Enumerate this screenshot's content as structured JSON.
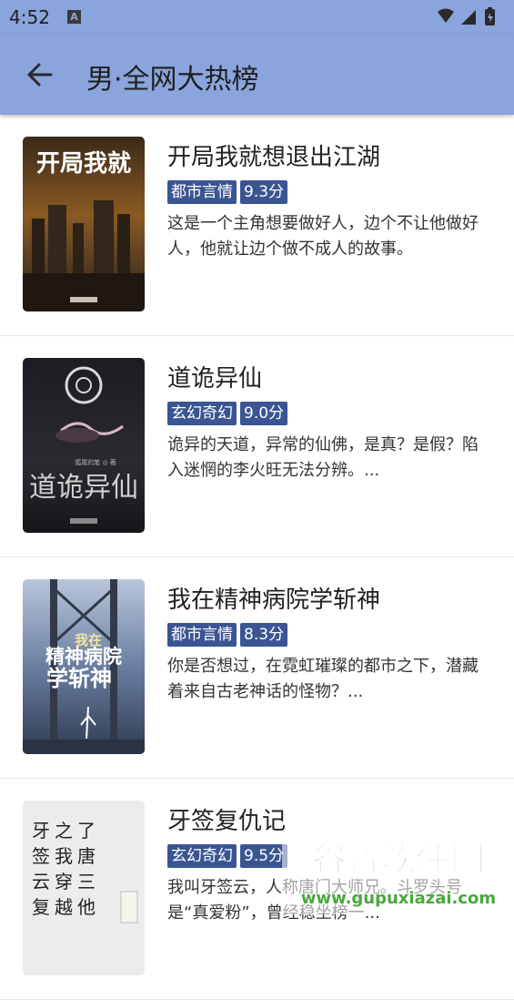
{
  "status_bar": {
    "time": "4:52",
    "notification_icon": "a-icon",
    "icons": [
      "wifi-icon",
      "signal-icon",
      "battery-icon"
    ]
  },
  "header": {
    "back_icon": "arrow-left-icon",
    "title": "男·全网大热榜"
  },
  "books": [
    {
      "title": "开局我就想退出江湖",
      "category": "都市言情",
      "score": "9.3分",
      "description": "这是一个主角想要做好人，边个不让他做好人，他就让边个做不成人的故事。",
      "cover_text": "开局我就"
    },
    {
      "title": "道诡异仙",
      "category": "玄幻奇幻",
      "score": "9.0分",
      "description": "诡异的天道，异常的仙佛，是真？是假？陷入迷惘的李火旺无法分辨。...",
      "cover_text": "道诡异仙",
      "cover_author": "狐尾的笔 ◎ 著"
    },
    {
      "title": "我在精神病院学斩神",
      "category": "都市言情",
      "score": "8.3分",
      "description": "你是否想过，在霓虹璀璨的都市之下，潜藏着来自古老神话的怪物？...",
      "cover_text_line1": "精神病院",
      "cover_text_line2": "学斩神",
      "cover_badge": "我在"
    },
    {
      "title": "牙签复仇记",
      "category": "玄幻奇幻",
      "score": "9.5分",
      "description": "我叫牙签云，人称唐门大师兄。斗罗头号是“真爱粉”，曾经稳坐榜一...",
      "cover_columns": [
        "牙签云复",
        "之我穿越",
        "了唐三他"
      ]
    }
  ],
  "watermark": {
    "brand": "谷普软件园",
    "url": "www.gupuxiazai.com"
  }
}
